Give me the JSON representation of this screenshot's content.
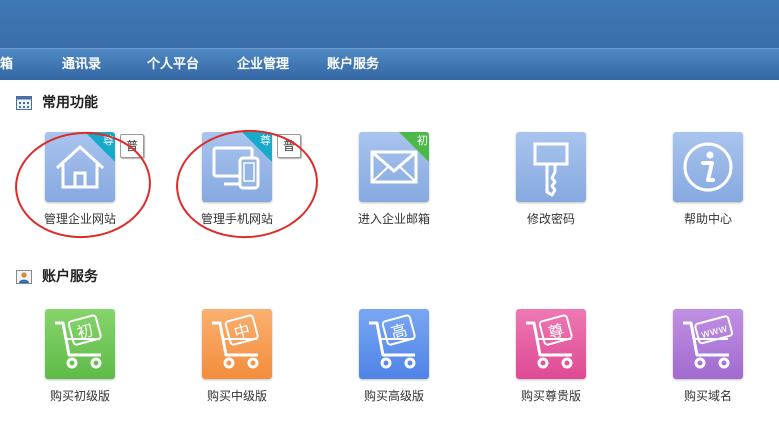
{
  "nav": {
    "items": [
      "箱",
      "通讯录",
      "个人平台",
      "企业管理",
      "账户服务"
    ]
  },
  "sections": {
    "common": {
      "title": "常用功能"
    },
    "account": {
      "title": "账户服务"
    }
  },
  "common_tiles": [
    {
      "label": "管理企业网站",
      "badge": "尊",
      "popup": "普"
    },
    {
      "label": "管理手机网站",
      "badge": "尊",
      "popup": "普"
    },
    {
      "label": "进入企业邮箱",
      "badge": "初"
    },
    {
      "label": "修改密码"
    },
    {
      "label": "帮助中心"
    }
  ],
  "account_tiles": [
    {
      "label": "购买初级版",
      "cart_text": "初"
    },
    {
      "label": "购买中级版",
      "cart_text": "中"
    },
    {
      "label": "购买高级版",
      "cart_text": "高"
    },
    {
      "label": "购买尊贵版",
      "cart_text": "尊"
    },
    {
      "label": "购买域名",
      "cart_text": "www"
    }
  ],
  "colors": {
    "banner": "#3f78b6",
    "nav": "#3a70ad",
    "tile_blue": "#8fb1e4",
    "badge_teal": "#19a9c9",
    "badge_green": "#4cb84a",
    "cart_green": "#6cc552",
    "cart_orange": "#f59b52",
    "cart_blue": "#5f93ee",
    "cart_pink": "#e55b9f",
    "cart_purple": "#ad76d6",
    "highlight_ring": "#e02a2a"
  }
}
